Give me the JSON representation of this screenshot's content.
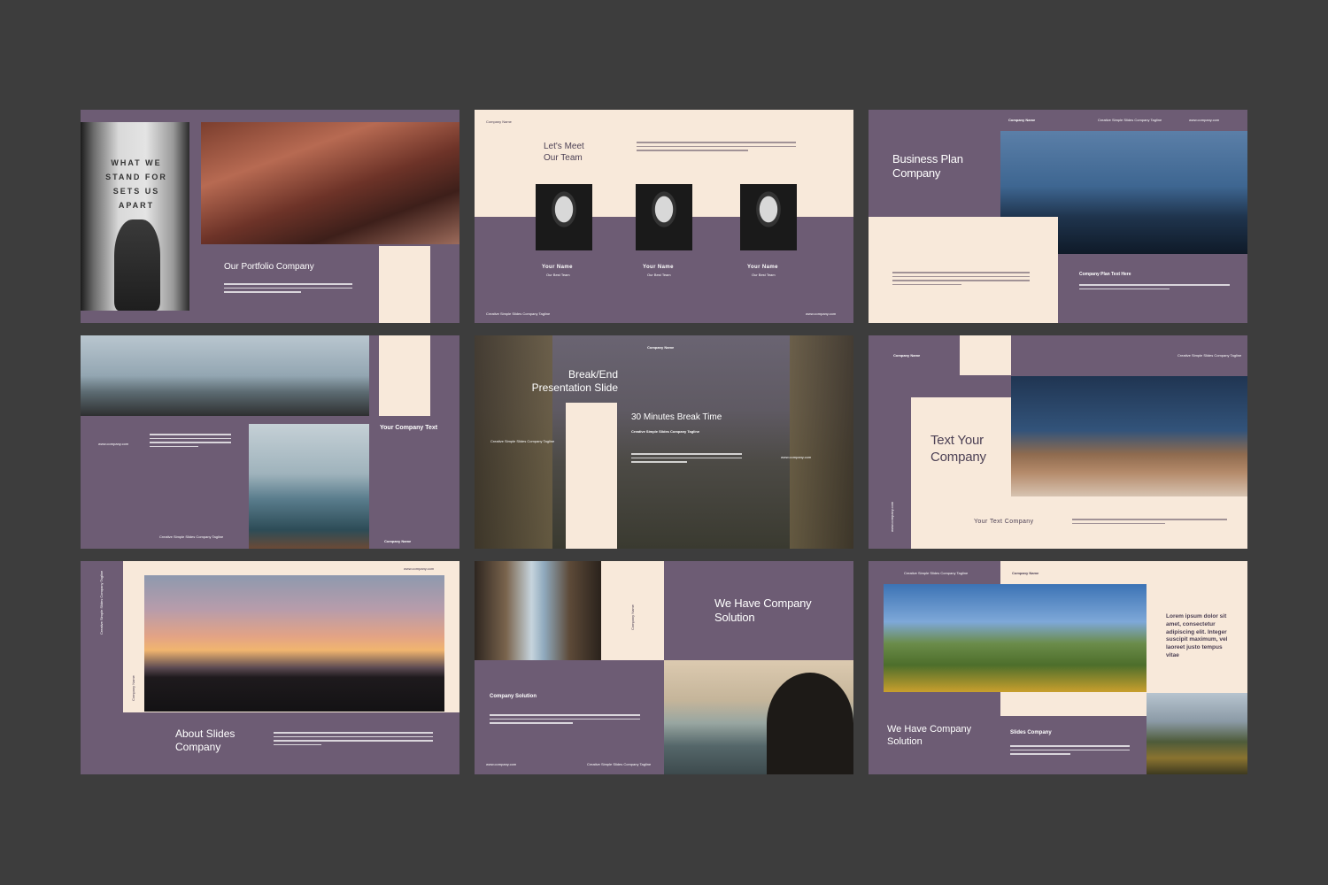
{
  "colors": {
    "background": "#3d3d3d",
    "purple": "#6d5c74",
    "cream": "#f8e9da"
  },
  "slides": {
    "s1": {
      "sign_text": "WHAT WE STAND FOR SETS US APART",
      "title": "Our Portfolio Company"
    },
    "s2": {
      "company": "Company Name",
      "title": "Let's Meet Our Team",
      "members": [
        {
          "name": "Your Name",
          "role": "Our Best Team"
        },
        {
          "name": "Your Name",
          "role": "Our Best Team"
        },
        {
          "name": "Your Name",
          "role": "Our Best Team"
        }
      ],
      "footer_left": "Creative Simple Slides Company Tagline",
      "footer_right": "www.company.com"
    },
    "s3": {
      "company": "Company Name",
      "tagline": "Creative Simple Slides Company Tagline",
      "website": "www.company.com",
      "title": "Business Plan Company",
      "subtitle": "Company Plan Text Here"
    },
    "s4": {
      "website": "www.company.com",
      "title": "Your Company Text",
      "footer": "Creative Simple Slides Company Tagline",
      "company": "Company Name"
    },
    "s5": {
      "company": "Company Name",
      "title": "Break/End Presentation Slide",
      "subtitle": "30 Minutes Break Time",
      "tagline": "Creative Simple Slides Company Tagline",
      "left_tag": "Creative Simple Slides Company Tagline",
      "website": "www.company.com"
    },
    "s6": {
      "company": "Company Name",
      "tagline": "Creative Simple Slides Company Tagline",
      "title": "Text Your Company",
      "subtitle": "Your Text Company",
      "vertical": "www.company.com"
    },
    "s7": {
      "website": "www.company.com",
      "vertical_top": "Creative Simple Slides Company Tagline",
      "vertical_bottom": "Company Name",
      "title": "About Slides Company"
    },
    "s8": {
      "vertical": "Company Name",
      "title": "We Have Company Solution",
      "subtitle": "Company Solution",
      "website": "www.company.com",
      "tagline": "Creative Simple Slides Company Tagline"
    },
    "s9": {
      "tagline": "Creative Simple Slides Company Tagline",
      "company": "Company Name",
      "quote": "Lorem ipsum dolor sit amet, consectetur adipiscing elit. Integer suscipit maximum, vel laoreet justo tempus vitae",
      "title": "We Have Company Solution",
      "subtitle": "Slides Company"
    }
  }
}
